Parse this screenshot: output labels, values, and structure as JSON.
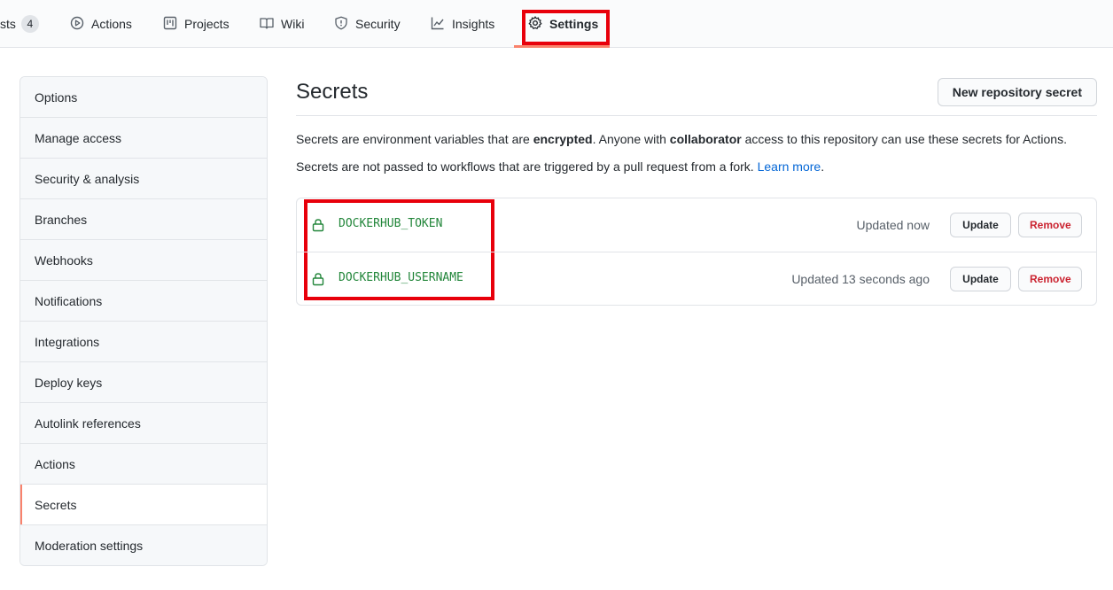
{
  "tabs": [
    {
      "label": "sts",
      "counter": "4"
    },
    {
      "label": "Actions"
    },
    {
      "label": "Projects"
    },
    {
      "label": "Wiki"
    },
    {
      "label": "Security"
    },
    {
      "label": "Insights"
    },
    {
      "label": "Settings"
    }
  ],
  "sidebar": {
    "items": [
      {
        "label": "Options"
      },
      {
        "label": "Manage access"
      },
      {
        "label": "Security & analysis"
      },
      {
        "label": "Branches"
      },
      {
        "label": "Webhooks"
      },
      {
        "label": "Notifications"
      },
      {
        "label": "Integrations"
      },
      {
        "label": "Deploy keys"
      },
      {
        "label": "Autolink references"
      },
      {
        "label": "Actions"
      },
      {
        "label": "Secrets"
      },
      {
        "label": "Moderation settings"
      }
    ],
    "selected": "Secrets"
  },
  "main": {
    "title": "Secrets",
    "new_secret_label": "New repository secret",
    "desc1": {
      "a": "Secrets are environment variables that are ",
      "b": "encrypted",
      "c": ". Anyone with ",
      "d": "collaborator",
      "e": " access to this repository can use these secrets for Actions."
    },
    "desc2": {
      "a": "Secrets are not passed to workflows that are triggered by a pull request from a fork. ",
      "link": "Learn more",
      "c": "."
    },
    "secrets": [
      {
        "name": "DOCKERHUB_TOKEN",
        "updated": "Updated now",
        "update_label": "Update",
        "remove_label": "Remove"
      },
      {
        "name": "DOCKERHUB_USERNAME",
        "updated": "Updated 13 seconds ago",
        "update_label": "Update",
        "remove_label": "Remove"
      }
    ]
  },
  "colors": {
    "accent_underline": "#f9826c",
    "highlight_box": "#e8000b",
    "secret_name": "#22863a",
    "link": "#0366d6",
    "danger": "#cb2431"
  },
  "icons": {
    "actions": "play-circle-icon",
    "projects": "project-board-icon",
    "wiki": "book-icon",
    "security": "shield-icon",
    "insights": "graph-icon",
    "settings": "gear-icon",
    "secret": "lock-icon"
  }
}
